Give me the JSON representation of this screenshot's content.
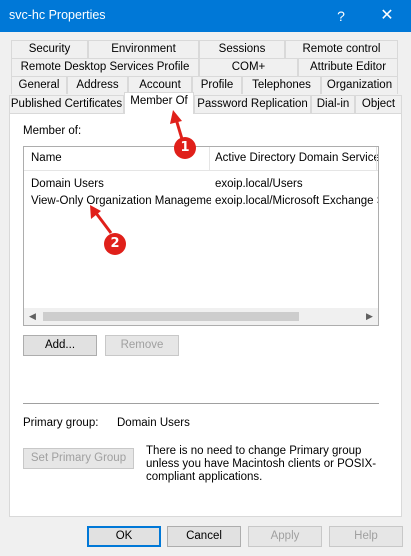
{
  "window": {
    "title": "svc-hc Properties",
    "help_glyph": "?",
    "close_glyph": "✕"
  },
  "tabs": {
    "row1": [
      "Security",
      "Environment",
      "Sessions",
      "Remote control"
    ],
    "row2": [
      "Remote Desktop Services Profile",
      "COM+",
      "Attribute Editor"
    ],
    "row3": [
      "General",
      "Address",
      "Account",
      "Profile",
      "Telephones",
      "Organization"
    ],
    "row4": [
      "Published Certificates",
      "Member Of",
      "Password Replication",
      "Dial-in",
      "Object"
    ],
    "active": "Member Of"
  },
  "member_of": {
    "label": "Member of:",
    "columns": [
      "Name",
      "Active Directory Domain Services"
    ],
    "rows": [
      {
        "name": "Domain Users",
        "folder": "exoip.local/Users"
      },
      {
        "name": "View-Only Organization Management",
        "folder": "exoip.local/Microsoft Exchange Se"
      }
    ],
    "scroll_left": "◀",
    "scroll_right": "▶"
  },
  "buttons": {
    "add": "Add...",
    "remove": "Remove",
    "set_primary": "Set Primary Group"
  },
  "primary_group": {
    "label": "Primary group:",
    "value": "Domain Users",
    "note": "There is no need to change Primary group unless you have Macintosh clients or POSIX-compliant applications."
  },
  "footer": {
    "ok": "OK",
    "cancel": "Cancel",
    "apply": "Apply",
    "help": "Help"
  },
  "annotations": {
    "marker1": "1",
    "marker2": "2",
    "color": "#e0201a"
  }
}
